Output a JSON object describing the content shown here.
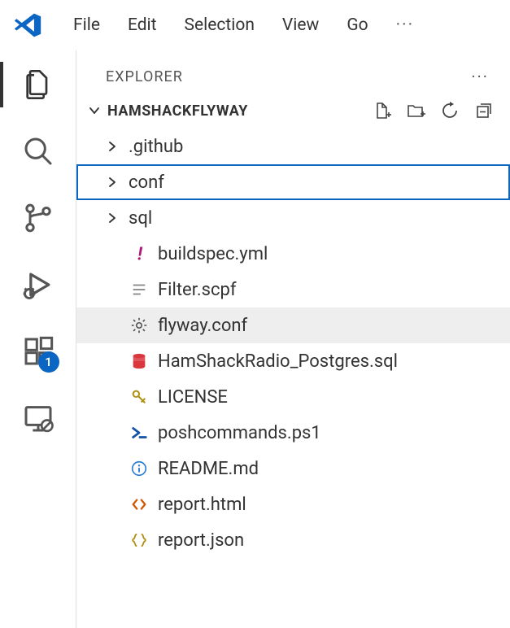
{
  "menubar": {
    "items": [
      "File",
      "Edit",
      "Selection",
      "View",
      "Go"
    ]
  },
  "activitybar": {
    "extensions_badge": "1"
  },
  "explorer": {
    "title": "EXPLORER",
    "project": "HAMSHACKFLYWAY",
    "tree": [
      {
        "name": ".github",
        "kind": "folder"
      },
      {
        "name": "conf",
        "kind": "folder",
        "selected": true
      },
      {
        "name": "sql",
        "kind": "folder"
      },
      {
        "name": "buildspec.yml",
        "kind": "file",
        "icon": "exclaim"
      },
      {
        "name": "Filter.scpf",
        "kind": "file",
        "icon": "lines"
      },
      {
        "name": "flyway.conf",
        "kind": "file",
        "icon": "gear",
        "hovered": true
      },
      {
        "name": "HamShackRadio_Postgres.sql",
        "kind": "file",
        "icon": "db"
      },
      {
        "name": "LICENSE",
        "kind": "file",
        "icon": "key"
      },
      {
        "name": "poshcommands.ps1",
        "kind": "file",
        "icon": "ps"
      },
      {
        "name": "README.md",
        "kind": "file",
        "icon": "info"
      },
      {
        "name": "report.html",
        "kind": "file",
        "icon": "angle"
      },
      {
        "name": "report.json",
        "kind": "file",
        "icon": "braces"
      }
    ]
  }
}
